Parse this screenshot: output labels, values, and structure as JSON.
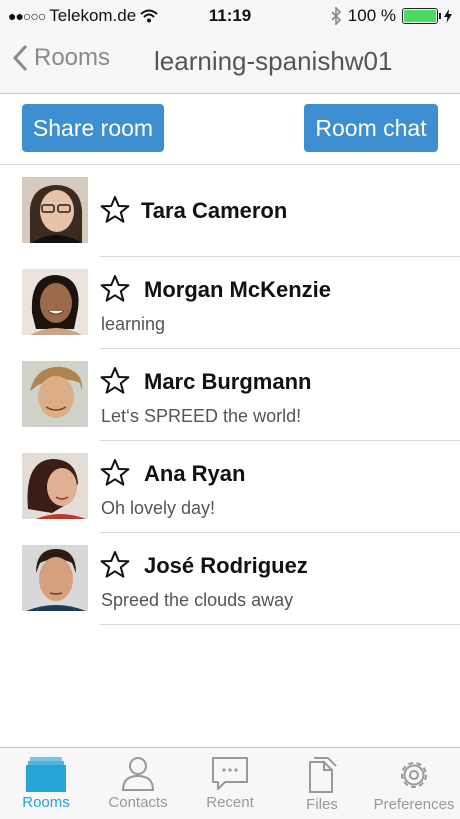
{
  "status_bar": {
    "carrier": "Telekom.de",
    "time": "11:19",
    "battery": "100 %",
    "battery_level": 1.0
  },
  "nav": {
    "back_label": "Rooms",
    "title": "learning-spanishw01"
  },
  "actions": {
    "share_label": "Share room",
    "chat_label": "Room chat"
  },
  "contacts": [
    {
      "name": "Tara Cameron",
      "status": ""
    },
    {
      "name": "Morgan McKenzie",
      "status": "learning"
    },
    {
      "name": "Marc Burgmann",
      "status": "Let‘s SPREED the world!"
    },
    {
      "name": "Ana Ryan",
      "status": "Oh lovely day!"
    },
    {
      "name": "José Rodriguez",
      "status": "Spreed the clouds away"
    }
  ],
  "tabs": [
    {
      "label": "Rooms",
      "icon": "rooms-icon",
      "active": true
    },
    {
      "label": "Contacts",
      "icon": "contacts-icon",
      "active": false
    },
    {
      "label": "Recent",
      "icon": "recent-icon",
      "active": false
    },
    {
      "label": "Files",
      "icon": "files-icon",
      "active": false
    },
    {
      "label": "Preferences",
      "icon": "gear-icon",
      "active": false
    }
  ],
  "colors": {
    "accent": "#27a4d8",
    "button": "#3d8fd2",
    "battery": "#4cd964"
  }
}
